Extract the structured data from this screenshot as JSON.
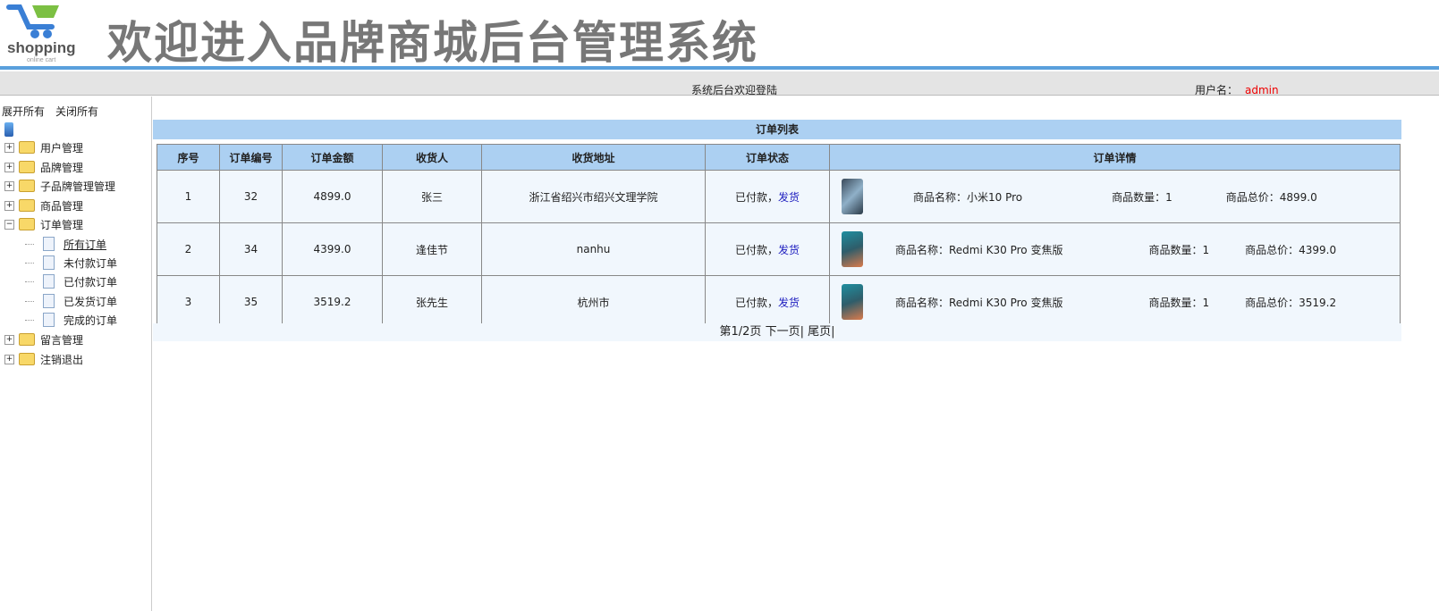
{
  "header": {
    "logo_text": "shopping",
    "logo_sub": "online cart",
    "title": "欢迎进入品牌商城后台管理系统"
  },
  "topbar": {
    "welcome": "系统后台欢迎登陆",
    "user_label": "用户名：",
    "user_value": "admin"
  },
  "sidebar": {
    "expand_all": "展开所有",
    "collapse_all": "关闭所有",
    "items": [
      {
        "label": "用户管理"
      },
      {
        "label": "品牌管理"
      },
      {
        "label": "子品牌管理管理"
      },
      {
        "label": "商品管理"
      },
      {
        "label": "订单管理",
        "expanded": true
      }
    ],
    "sub_items": [
      {
        "label": "所有订单"
      },
      {
        "label": "未付款订单"
      },
      {
        "label": "已付款订单"
      },
      {
        "label": "已发货订单"
      },
      {
        "label": "完成的订单"
      }
    ],
    "bottom_items": [
      {
        "label": "留言管理"
      },
      {
        "label": "注销退出"
      }
    ]
  },
  "list": {
    "title": "订单列表",
    "headers": [
      "序号",
      "订单编号",
      "订单金额",
      "收货人",
      "收货地址",
      "订单状态",
      "订单详情"
    ],
    "rows": [
      {
        "no": "1",
        "id": "32",
        "amount": "4899.0",
        "receiver": "张三",
        "address": "浙江省绍兴市绍兴文理学院",
        "status": "已付款，",
        "action": "发货",
        "name": "商品名称：小米10 Pro",
        "qty": "商品数量：1",
        "total": "商品总价：4899.0"
      },
      {
        "no": "2",
        "id": "34",
        "amount": "4399.0",
        "receiver": "逢佳节",
        "address": "nanhu",
        "status": "已付款，",
        "action": "发货",
        "name": "商品名称：Redmi K30 Pro 变焦版",
        "qty": "商品数量：1",
        "total": "商品总价：4399.0"
      },
      {
        "no": "3",
        "id": "35",
        "amount": "3519.2",
        "receiver": "张先生",
        "address": "杭州市",
        "status": "已付款，",
        "action": "发货",
        "name": "商品名称：Redmi K30 Pro 变焦版",
        "qty": "商品数量：1",
        "total": "商品总价：3519.2"
      }
    ]
  },
  "pager": {
    "info": "第1/2页",
    "next": "下一页|",
    "last": "尾页|"
  },
  "colors": {
    "accent": "#5aa0dc",
    "table_header": "#acd0f2",
    "link": "#2020c0",
    "user": "#e00000"
  }
}
